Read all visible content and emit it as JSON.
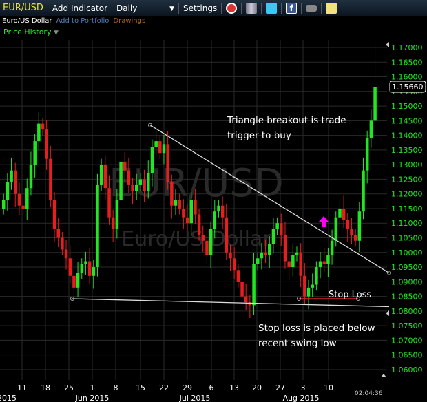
{
  "toolbar": {
    "symbol": "EUR/USD",
    "add_indicator": "Add Indicator",
    "interval": "Daily",
    "interval_arrow": "▼",
    "settings": "Settings",
    "icons": [
      "alarm-clock-icon",
      "database-icon",
      "twitter-icon",
      "facebook-icon",
      "camera-icon",
      "notepad-icon"
    ]
  },
  "subbar": {
    "name": "Euro/US Dollar",
    "add_portfolio": "Add to Portfolio",
    "drawings": "Drawings"
  },
  "view": {
    "label": "Price History",
    "arrow": "▼"
  },
  "watermark": {
    "symbol": "EUR/USD",
    "name": "Euro/US Dollar"
  },
  "annotations": {
    "breakout_line1": "Triangle breakout is trade",
    "breakout_line2": "trigger to buy",
    "stop_loss_label": "Stop Loss",
    "stop_line1": "Stop loss is placed below",
    "stop_line2": "recent swing low"
  },
  "clock": "02:04:36",
  "colors": {
    "up": "#22e622",
    "down": "#e61e1e",
    "axis": "#22e622",
    "arrow": "#ff00ff"
  },
  "chart_data": {
    "type": "candlestick",
    "title": "EUR/USD Daily",
    "ylim": [
      1.06,
      1.17
    ],
    "y_ticks": [
      "1.17000",
      "1.16500",
      "1.16000",
      "1.15500",
      "1.15000",
      "1.14500",
      "1.14000",
      "1.13500",
      "1.13000",
      "1.12500",
      "1.12000",
      "1.11500",
      "1.11000",
      "1.10500",
      "1.10000",
      "1.09500",
      "1.09000",
      "1.08500",
      "1.08000",
      "1.07500",
      "1.07000",
      "1.06500",
      "1.06000"
    ],
    "last_price": "1.15660",
    "x_day_ticks": [
      "11",
      "18",
      "25",
      "1",
      "8",
      "15",
      "22",
      "29",
      "6",
      "13",
      "20",
      "27",
      "3",
      "10"
    ],
    "x_month_ticks": [
      "2015",
      "Jun 2015",
      "Jul 2015",
      "Aug 2015"
    ],
    "closes": [
      1.118,
      1.124,
      1.128,
      1.12,
      1.116,
      1.115,
      1.122,
      1.13,
      1.138,
      1.144,
      1.142,
      1.132,
      1.118,
      1.108,
      1.105,
      1.101,
      1.098,
      1.092,
      1.088,
      1.093,
      1.096,
      1.097,
      1.092,
      1.095,
      1.123,
      1.13,
      1.122,
      1.112,
      1.108,
      1.118,
      1.131,
      1.128,
      1.123,
      1.121,
      1.123,
      1.125,
      1.121,
      1.127,
      1.136,
      1.138,
      1.134,
      1.137,
      1.124,
      1.116,
      1.118,
      1.115,
      1.112,
      1.11,
      1.118,
      1.113,
      1.106,
      1.104,
      1.099,
      1.108,
      1.114,
      1.116,
      1.112,
      1.1,
      1.098,
      1.094,
      1.09,
      1.085,
      1.083,
      1.082,
      1.096,
      1.098,
      1.1,
      1.099,
      1.103,
      1.108,
      1.11,
      1.106,
      1.097,
      1.095,
      1.099,
      1.1,
      1.092,
      1.085,
      1.088,
      1.089,
      1.095,
      1.097,
      1.096,
      1.099,
      1.104,
      1.112,
      1.115,
      1.111,
      1.108,
      1.106,
      1.104,
      1.114,
      1.128,
      1.139,
      1.145,
      1.1566
    ],
    "trendlines": [
      {
        "name": "triangle-resistance",
        "from_price": 1.1435,
        "to_price": 1.093
      },
      {
        "name": "triangle-support",
        "from_price": 1.0842,
        "to_price": 1.0815
      },
      {
        "name": "stop-loss",
        "price": 1.0842
      }
    ]
  }
}
